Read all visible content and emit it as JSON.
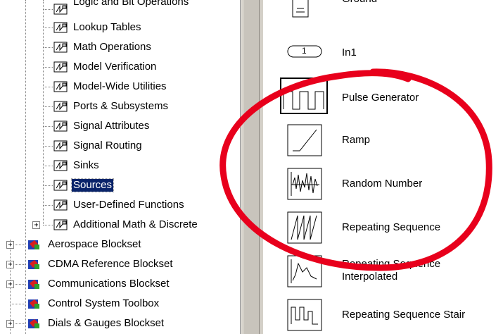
{
  "tree": {
    "libraries": [
      {
        "label": "Logic and Bit Operations"
      },
      {
        "label": "Lookup Tables"
      },
      {
        "label": "Math Operations"
      },
      {
        "label": "Model Verification"
      },
      {
        "label": "Model-Wide Utilities"
      },
      {
        "label": "Ports & Subsystems"
      },
      {
        "label": "Signal Attributes"
      },
      {
        "label": "Signal Routing"
      },
      {
        "label": "Sinks"
      },
      {
        "label": "Sources",
        "selected": true
      },
      {
        "label": "User-Defined Functions"
      },
      {
        "label": "Additional Math & Discrete",
        "expandable": true
      }
    ],
    "blocksets": [
      {
        "label": "Aerospace Blockset",
        "expandable": true
      },
      {
        "label": "CDMA Reference Blockset",
        "expandable": true
      },
      {
        "label": "Communications Blockset",
        "expandable": true
      },
      {
        "label": "Control System Toolbox",
        "expandable": false
      },
      {
        "label": "Dials & Gauges Blockset",
        "expandable": true
      }
    ],
    "expander_glyph": "+"
  },
  "blocks": [
    {
      "label": "Ground",
      "icon": "ground-icon"
    },
    {
      "label": "In1",
      "icon": "inport-icon",
      "icon_text": "1"
    },
    {
      "label": "Pulse Generator",
      "icon": "pulse-generator-icon"
    },
    {
      "label": "Ramp",
      "icon": "ramp-icon"
    },
    {
      "label": "Random Number",
      "icon": "random-number-icon"
    },
    {
      "label": "Repeating Sequence",
      "icon": "repeating-sequence-icon"
    },
    {
      "label": "Repeating Sequence Interpolated",
      "icon": "repeating-sequence-interpolated-icon"
    },
    {
      "label": "Repeating Sequence Stair",
      "icon": "repeating-sequence-stair-icon"
    }
  ],
  "annotation": {
    "shape": "ellipse",
    "color": "#e8001c"
  },
  "colors": {
    "selection": "#0a246a",
    "splitter": "#d4d0c8"
  }
}
